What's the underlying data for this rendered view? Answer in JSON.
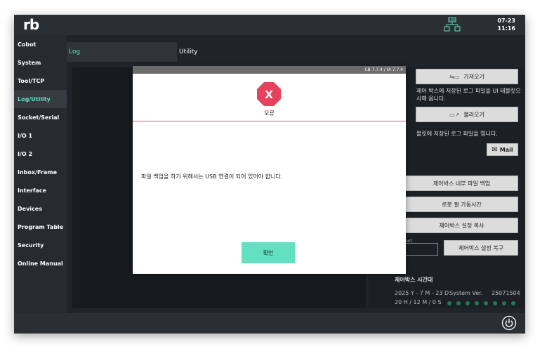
{
  "header": {
    "logo_text": "rb",
    "date": "07-23",
    "time": "11:16",
    "icon_usb": "usb-network-icon"
  },
  "sidebar": {
    "items": [
      {
        "label": "Cobot"
      },
      {
        "label": "System"
      },
      {
        "label": "Tool/TCP"
      },
      {
        "label": "Log/Utility",
        "active": true
      },
      {
        "label": "Socket/Serial"
      },
      {
        "label": "I/O 1"
      },
      {
        "label": "I/O 2"
      },
      {
        "label": "Inbox/Frame"
      },
      {
        "label": "Interface"
      },
      {
        "label": "Devices"
      },
      {
        "label": "Program Table"
      },
      {
        "label": "Security"
      },
      {
        "label": "Online Manual"
      }
    ]
  },
  "tabs": {
    "log": "Log",
    "utility": "Utility"
  },
  "right_panel": {
    "fetch_button": "가져오기",
    "fetch_desc_1": "제어 박스에 저장된 로그 파일을 UI 태블릿으",
    "fetch_desc_2": "사해 옵니다.",
    "load_button": "불러오기",
    "load_desc": "블릿에 저장된 로그 파일을 엽니다.",
    "mail_button": "Mail",
    "internal_backup_button": "제어박스 내부 파일 백업",
    "robot_uptime_button": "로봇 팔 가동시간",
    "settings_copy_button": "제어박스 설정 복사",
    "input_label": "ent",
    "settings_restore_button": "제어박스 설정 복구",
    "controlbox_time_title": "제어박스 시간대",
    "date_line": "2025 Y - 7 M - 23 D",
    "time_line": "20 H / 12 M / 0 S",
    "system_ver_label": "System Ver.",
    "system_ver_value": "25071504"
  },
  "modal": {
    "version": "CB 7.7.4 / UI 7.7.4",
    "icon_symbol": "X",
    "title": "오류",
    "message": "파일 백업을 하기 위해서는 USB 연결이 되어 있어야 합니다.",
    "confirm_label": "확인"
  },
  "colors": {
    "accent": "#5ee0c3",
    "error": "#e8415e",
    "confirm": "#63e0c0"
  }
}
